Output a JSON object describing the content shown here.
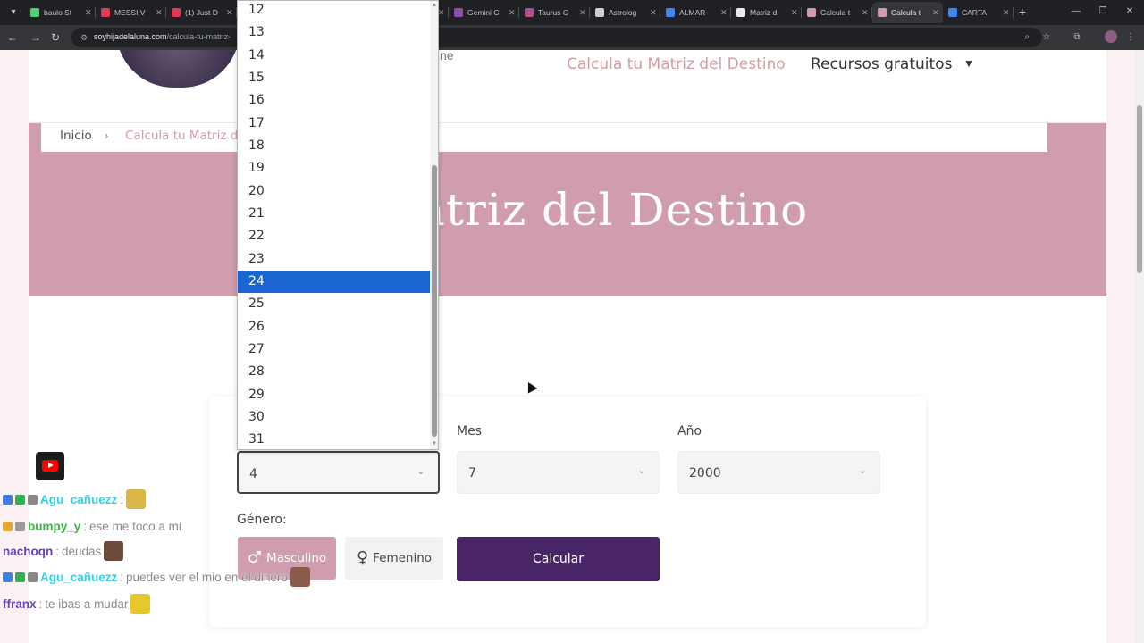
{
  "browser": {
    "tabs": [
      {
        "title": "baulo St",
        "color": "#53d06e",
        "active": false
      },
      {
        "title": "MESSI V",
        "color": "#e03a52",
        "active": false
      },
      {
        "title": "(1) Just D",
        "color": "#e03a52",
        "active": false
      },
      {
        "title": "",
        "color": "#777777",
        "active": false
      },
      {
        "title": "",
        "color": "#777777",
        "active": false
      },
      {
        "title": "",
        "color": "#777777",
        "active": false
      },
      {
        "title": "Gemini C",
        "color": "#8a4fb0",
        "active": false
      },
      {
        "title": "Taurus C",
        "color": "#b04f8a",
        "active": false
      },
      {
        "title": "Astrolog",
        "color": "#d0d0d0",
        "active": false
      },
      {
        "title": "ALMAR",
        "color": "#4285f4",
        "active": false
      },
      {
        "title": "Matriz d",
        "color": "#e8eaed",
        "active": false
      },
      {
        "title": "Calcula t",
        "color": "#cf9dab",
        "active": false
      },
      {
        "title": "Calcula t",
        "color": "#cf9dab",
        "active": true
      },
      {
        "title": "CARTA",
        "color": "#4285f4",
        "active": false
      }
    ],
    "url_host": "soyhijadelaluna.com",
    "url_path": "/calcula-tu-matriz-"
  },
  "header": {
    "logo_tail": "ne",
    "nav_matriz": "Calcula tu Matriz del Destino",
    "nav_recursos": "Recursos gratuitos",
    "accent_color": "#d99aa3"
  },
  "breadcrumb": {
    "home": "Inicio",
    "current": "Calcula tu Matriz d"
  },
  "hero": {
    "title": "u Matriz del Destino",
    "bg_color": "#cf9dab"
  },
  "form": {
    "dia_value": "4",
    "mes_label": "Mes",
    "mes_value": "7",
    "ano_label": "Año",
    "ano_value": "2000",
    "genero_label": "Género:",
    "masculino": "Masculino",
    "femenino": "Femenino",
    "calcular": "Calcular",
    "button_color": "#4a2566"
  },
  "dropdown": {
    "options": [
      "12",
      "13",
      "14",
      "15",
      "16",
      "17",
      "18",
      "19",
      "20",
      "21",
      "22",
      "23",
      "24",
      "25",
      "26",
      "27",
      "28",
      "29",
      "30",
      "31"
    ],
    "highlighted": "24",
    "highlight_color": "#1a66d1"
  },
  "chat": [
    {
      "user": "Agu_cañuezz",
      "user_color": "#2fd0e6",
      "message": "",
      "badges": [
        "#3f7fe0",
        "#2fb34d",
        "#888888"
      ],
      "emote": "#d9b847"
    },
    {
      "user": "bumpy_y",
      "user_color": "#3bb34a",
      "message": "ese me toco a mi",
      "badges": [
        "#e0a92b",
        "#999999"
      ],
      "emote": ""
    },
    {
      "user": "nachoqn",
      "user_color": "#6a3fc0",
      "message": "deudas",
      "badges": [],
      "emote": "#6d4a3a"
    },
    {
      "user": "Agu_cañuezz",
      "user_color": "#2fd0e6",
      "message": "puedes ver el mio en el dinero",
      "badges": [
        "#3f7fe0",
        "#2fb34d",
        "#888888"
      ],
      "emote": "#8a5a4a"
    },
    {
      "user": "ffranx",
      "user_color": "#6a3fc0",
      "message": "te ibas a mudar",
      "badges": [],
      "emote": "#e6c82a"
    }
  ]
}
